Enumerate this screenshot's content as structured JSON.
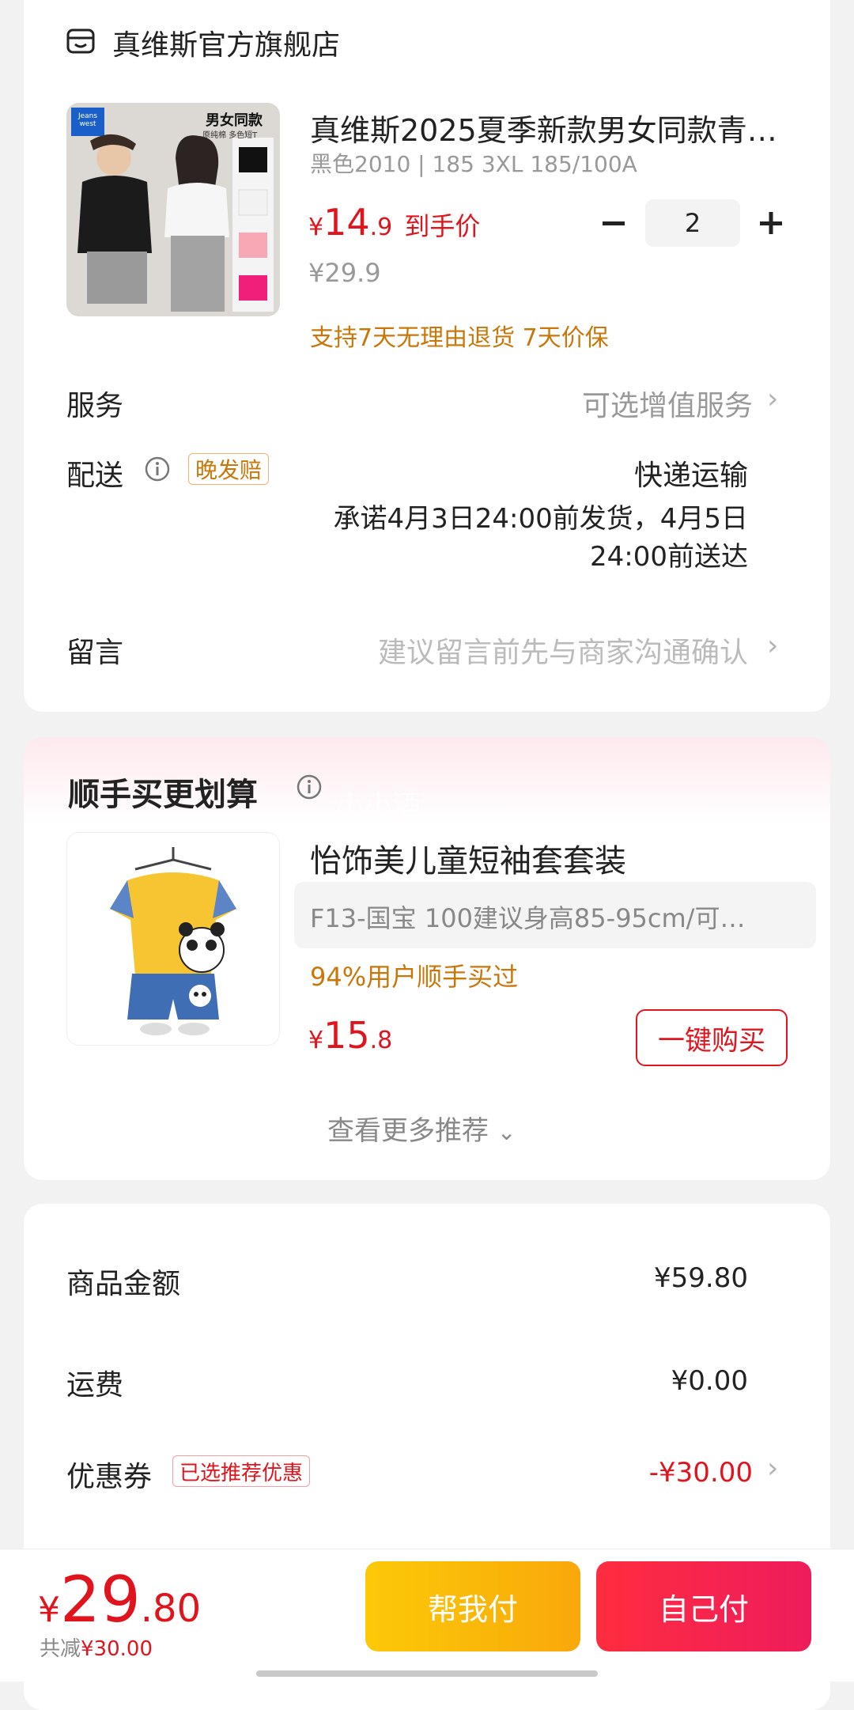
{
  "shop": {
    "name": "真维斯官方旗舰店",
    "icon": "store-icon"
  },
  "product": {
    "title": "真维斯2025夏季新款男女同款青…",
    "variant": "黑色2010 | 185 3XL 185/100A",
    "price_int": "14",
    "price_dec": ".9",
    "price_label": "到手价",
    "original_price": "¥29.9",
    "quantity": "2",
    "guarantee": "支持7天无理由退货  7天价保",
    "image_badge": "男女同款",
    "image_badge_sub": "原纯棉 多色短T",
    "image_brand": "Jeans west",
    "currency": "¥"
  },
  "service": {
    "label": "服务",
    "value": "可选增值服务"
  },
  "delivery": {
    "label": "配送",
    "tag": "晚发赔",
    "method": "快递运输",
    "promise_line1": "承诺4月3日24:00前发货，4月5日",
    "promise_line2": "24:00前送达"
  },
  "message": {
    "label": "留言",
    "placeholder": "建议留言前先与商家沟通确认"
  },
  "recommend": {
    "title": "顺手买更划算",
    "watermark": "小小酒",
    "item": {
      "title": "怡饰美儿童短袖套套装",
      "variant": "F13-国宝   100建议身高85-95cm/可…",
      "bought": "94%用户顺手买过",
      "price_int": "15",
      "price_dec": ".8",
      "buy_label": "一键购买"
    },
    "more": "查看更多推荐"
  },
  "summary": {
    "goods_label": "商品金额",
    "goods_value": "¥59.80",
    "shipping_label": "运费",
    "shipping_value": "¥0.00",
    "coupon_label": "优惠券",
    "coupon_tag": "已选推荐优惠",
    "coupon_value": "-¥30.00"
  },
  "bottom": {
    "currency": "¥",
    "total_int": "29",
    "total_dec": ".80",
    "saved_prefix": "共减",
    "saved_value": "¥30.00",
    "help_pay": "帮我付",
    "self_pay": "自己付"
  },
  "colors": {
    "accent_red": "#e0141d",
    "orange_text": "#c8780a",
    "help_pay_bg": "#fcbc06",
    "self_pay_bg": "#f0244a"
  }
}
